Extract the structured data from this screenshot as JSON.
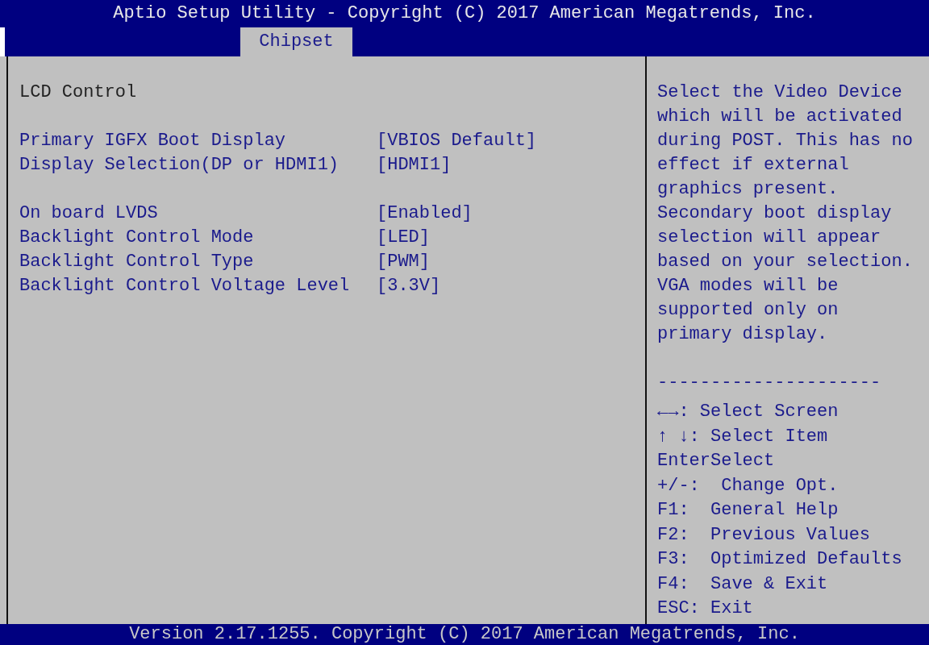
{
  "window": {
    "title": "Aptio Setup Utility - Copyright (C) 2017 American Megatrends, Inc."
  },
  "tabs": [
    {
      "label": "Chipset",
      "selected": true
    }
  ],
  "settings": {
    "heading": "LCD Control",
    "groups": [
      [
        {
          "label": "Primary IGFX Boot Display",
          "value": "[VBIOS Default]"
        },
        {
          "label": "Display Selection(DP or HDMI1)",
          "value": "[HDMI1]"
        }
      ],
      [
        {
          "label": "On board LVDS",
          "value": "[Enabled]"
        },
        {
          "label": "Backlight Control Mode",
          "value": "[LED]"
        },
        {
          "label": "Backlight Control Type",
          "value": "[PWM]"
        },
        {
          "label": "Backlight Control Voltage Level",
          "value": "[3.3V]"
        }
      ]
    ]
  },
  "help": {
    "description": "Select the Video Device which will be activated during POST. This has no effect if external graphics present. Secondary boot display selection will appear based on your selection. VGA modes will be supported only on primary display.",
    "separator": "---------------------",
    "keys": [
      "←→: Select Screen",
      "↑ ↓: Select Item",
      "EnterSelect",
      "+/-:  Change Opt.",
      "F1:  General Help",
      "F2:  Previous Values",
      "F3:  Optimized Defaults",
      "F4:  Save & Exit",
      "ESC: Exit"
    ]
  },
  "status_bar": "Version 2.17.1255. Copyright (C) 2017 American Megatrends, Inc."
}
